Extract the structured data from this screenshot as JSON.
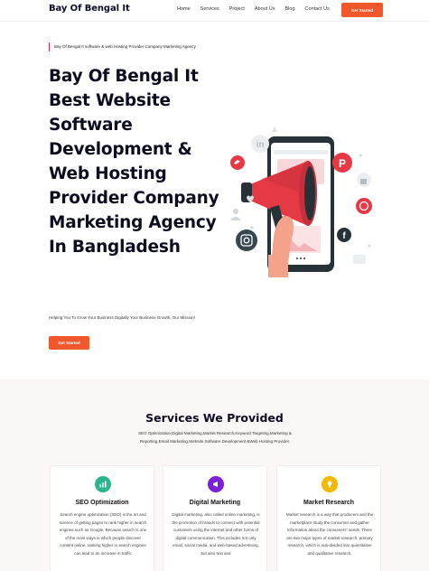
{
  "header": {
    "logo": "Bay Of Bengal It",
    "nav": [
      "Home",
      "Services",
      "Project",
      "About Us",
      "Blog",
      "Contact Us"
    ],
    "cta": "Get Started"
  },
  "hero": {
    "tagline": "Bay Of Bengal It software & web Hosting Provider Company Marketing Agency",
    "title": "Bay Of Bengal It Best Website Software Development & Web Hosting Provider Company Marketing Agency In Bangladesh",
    "subtitle": "Helping You To Grow Your Business Digitally Your Business Growth, Our Mission!",
    "cta": "Get Started"
  },
  "services": {
    "title": "Services We Provided",
    "description": "SEO Optimization,Digital Marketing,Market Research,Keyword Targeting,Marketing & Reporting,Email Marketing,Website,Software Development &Web Hosting Provider.",
    "cards": [
      {
        "title": "SEO Optimization",
        "text": "Search engine optimization (SEO) is the art and science of getting pages to rank higher in search engines such as Google. Because search is one of the main ways in which people discover content online, ranking higher in search engines can lead to an increase in traffic",
        "color": "#2bb58f",
        "icon": "chart-icon"
      },
      {
        "title": "Digital Marketing",
        "text": "Digital marketing, also called online marketing, is the promotion of brands to connect with potential customers using the internet and other forms of digital communication. This includes not only email, social media, and web-based advertising, but also text and",
        "color": "#7b22d6",
        "icon": "megaphone-icon"
      },
      {
        "title": "Market Research",
        "text": "Market research is a way that producers and the marketplace study the consumer and gather information about the consumers' needs. There are two major types of market research: primary research, which is sub-divided into quantitative and qualitative research,",
        "color": "#f5b800",
        "icon": "lightbulb-icon"
      }
    ]
  },
  "colors": {
    "accent": "#f1572c",
    "megaphone": "#e63946",
    "phone": "#263238"
  }
}
